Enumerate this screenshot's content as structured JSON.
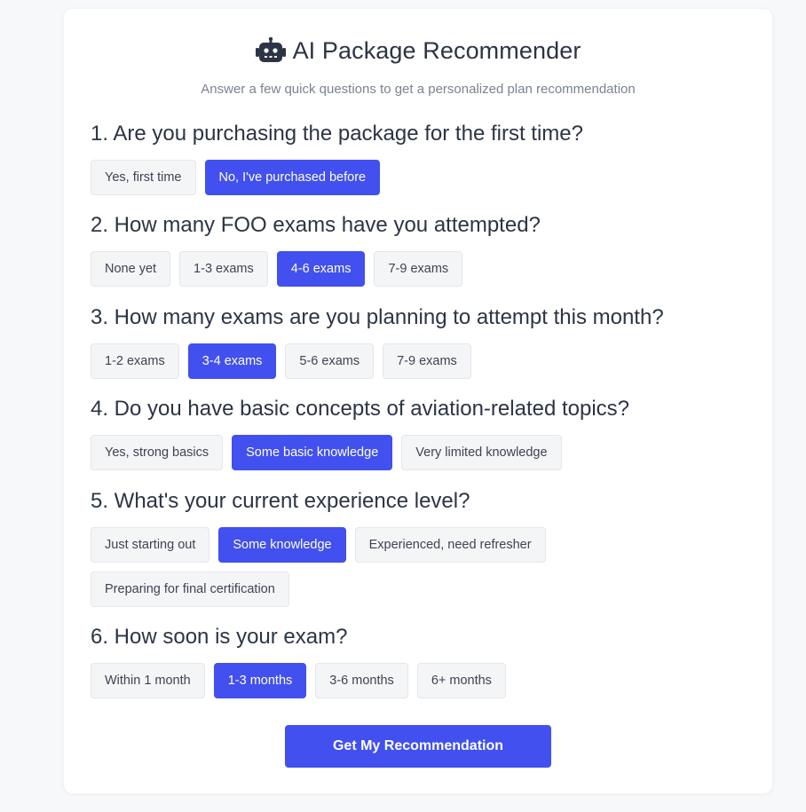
{
  "header": {
    "icon": "robot-icon",
    "title": "AI Package Recommender",
    "subtitle": "Answer a few quick questions to get a personalized plan recommendation"
  },
  "questions": [
    {
      "label": "1. Are you purchasing the package for the first time?",
      "options": [
        "Yes, first time",
        "No, I've purchased before"
      ],
      "selected": "No, I've purchased before"
    },
    {
      "label": "2. How many FOO exams have you attempted?",
      "options": [
        "None yet",
        "1-3 exams",
        "4-6 exams",
        "7-9 exams"
      ],
      "selected": "4-6 exams"
    },
    {
      "label": "3. How many exams are you planning to attempt this month?",
      "options": [
        "1-2 exams",
        "3-4 exams",
        "5-6 exams",
        "7-9 exams"
      ],
      "selected": "3-4 exams"
    },
    {
      "label": "4. Do you have basic concepts of aviation-related topics?",
      "options": [
        "Yes, strong basics",
        "Some basic knowledge",
        "Very limited knowledge"
      ],
      "selected": "Some basic knowledge"
    },
    {
      "label": "5. What's your current experience level?",
      "options": [
        "Just starting out",
        "Some knowledge",
        "Experienced, need refresher",
        "Preparing for final certification"
      ],
      "selected": "Some knowledge"
    },
    {
      "label": "6. How soon is your exam?",
      "options": [
        "Within 1 month",
        "1-3 months",
        "3-6 months",
        "6+ months"
      ],
      "selected": "1-3 months"
    }
  ],
  "submit_label": "Get My Recommendation",
  "colors": {
    "accent": "#4150ee",
    "option_bg": "#f4f5f7",
    "text": "#2c3445",
    "muted": "#7a8291"
  }
}
